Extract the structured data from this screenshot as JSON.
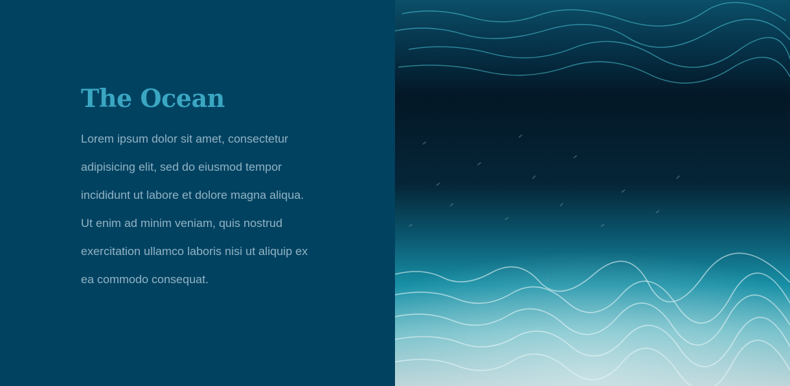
{
  "section": {
    "title": "The Ocean",
    "body": "Lorem ipsum dolor sit amet, consectetur adipisicing elit, sed do eiusmod tempor incididunt ut labore et dolore magna aliqua. Ut enim ad minim veniam, quis nostrud exercitation ullamco laboris nisi ut aliquip ex ea commodo consequat."
  },
  "colors": {
    "panel_background": "#014261",
    "heading": "#3aa6c2",
    "body_text": "#93b3c4"
  }
}
